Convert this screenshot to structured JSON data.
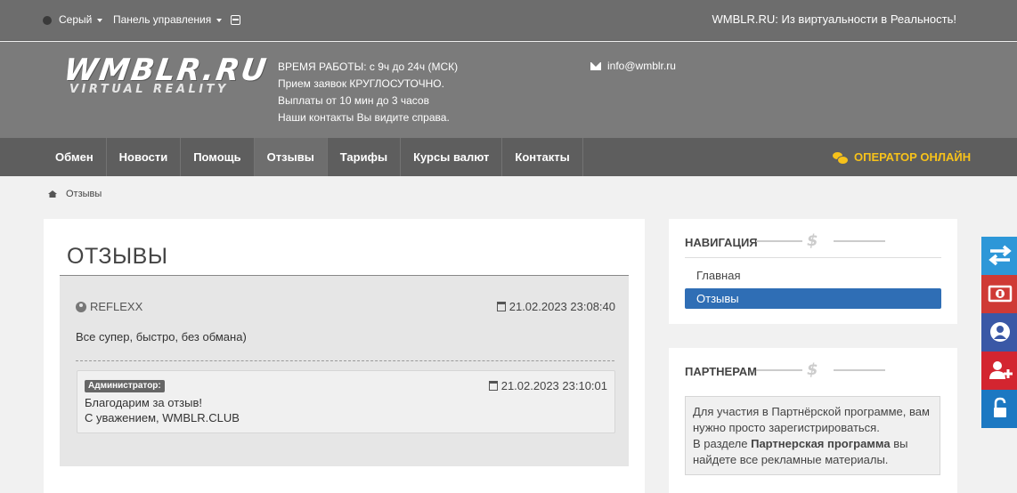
{
  "topbar": {
    "theme_label": "Серый",
    "panel_label": "Панель управления",
    "slogan": "WMBLR.RU: Из виртуальности в Реальность!"
  },
  "header": {
    "logo_main": "WMBLR.RU",
    "logo_sub": "VIRTUAL REALITY",
    "info_lines": [
      "ВРЕМЯ РАБОТЫ: с 9ч до 24ч (МСК)",
      "Прием заявок КРУГЛОСУТОЧНО.",
      "Выплаты от 10 мин до 3 часов",
      "Наши контакты Вы видите справа."
    ],
    "email": "info@wmblr.ru"
  },
  "nav": {
    "items": [
      {
        "label": "Обмен"
      },
      {
        "label": "Новости"
      },
      {
        "label": "Помощь"
      },
      {
        "label": "Отзывы",
        "active": true
      },
      {
        "label": "Тарифы"
      },
      {
        "label": "Курсы валют"
      },
      {
        "label": "Контакты"
      }
    ],
    "operator": "ОПЕРАТОР ОНЛАЙН"
  },
  "breadcrumb": {
    "current": "Отзывы"
  },
  "main": {
    "title": "ОТЗЫВЫ",
    "review": {
      "author": "REFLEXX",
      "date": "21.02.2023 23:08:40",
      "text": "Все супер, быстро, без обмана)",
      "answer": {
        "badge": "Администратор:",
        "date": "21.02.2023 23:10:01",
        "line1": "Благодарим за отзыв!",
        "line2": "С уважением, WMBLR.CLUB"
      }
    }
  },
  "sidebar": {
    "nav_title": "НАВИГАЦИЯ",
    "nav_items": [
      {
        "label": "Главная"
      },
      {
        "label": "Отзывы",
        "active": true
      }
    ],
    "partner_title": "ПАРТНЕРАМ",
    "partner_text_1": "Для участия в Партнёрской программе, вам нужно просто зарегистрироваться.",
    "partner_text_2a": "В разделе ",
    "partner_text_2b": "Партнерская программа",
    "partner_text_2c": " вы найдете все рекламные материалы."
  },
  "colors": {
    "accent_blue": "#2f6eb5",
    "operator_yellow": "#f7c21a",
    "fixed_buttons": [
      "#2d97d8",
      "#cf3a35",
      "#3a58a6",
      "#d32530",
      "#1c78c2"
    ]
  }
}
